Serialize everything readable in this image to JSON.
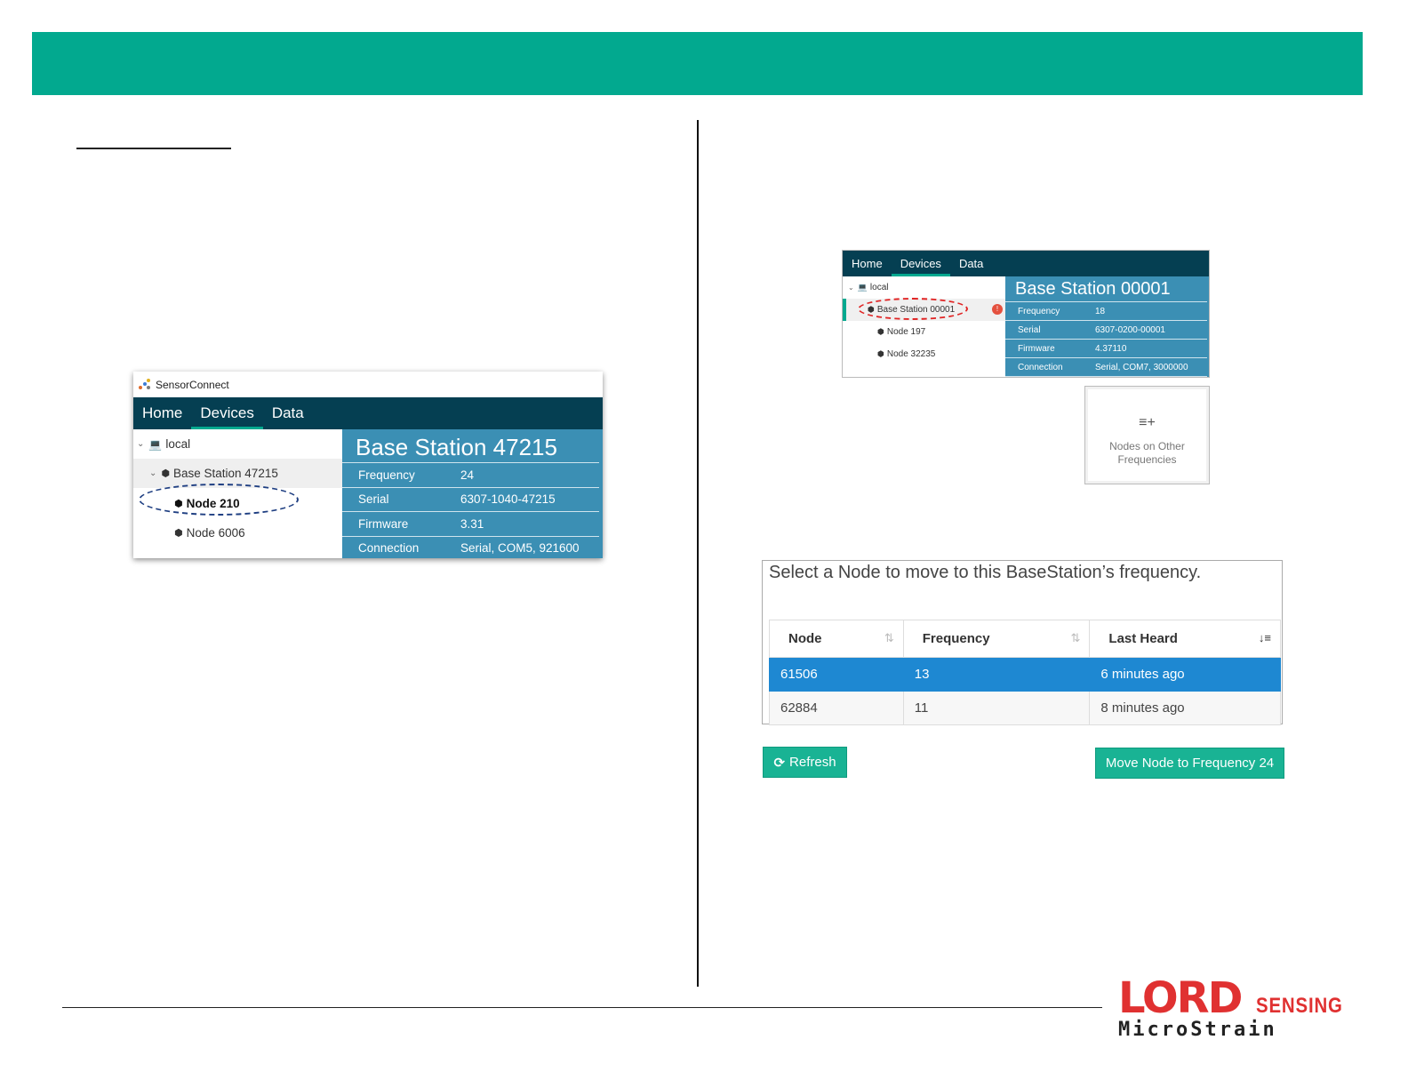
{
  "colors": {
    "banner": "#02a98f",
    "nav_bg": "#053f52",
    "panel_bg": "#3b8fb4",
    "button_bg": "#19b394",
    "selection": "#1e88d2",
    "logo_red": "#e03131"
  },
  "shot1": {
    "app_title": "SensorConnect",
    "tabs": [
      "Home",
      "Devices",
      "Data"
    ],
    "active_tab": "Devices",
    "tree": [
      {
        "label": "local",
        "icon": "laptop-icon"
      },
      {
        "label": "Base Station 47215",
        "icon": "device-icon"
      },
      {
        "label": "Node 210",
        "icon": "device-icon"
      },
      {
        "label": "Node 6006",
        "icon": "device-icon"
      }
    ],
    "panel_title": "Base Station 47215",
    "properties": [
      {
        "key": "Frequency",
        "value": "24"
      },
      {
        "key": "Serial",
        "value": "6307-1040-47215"
      },
      {
        "key": "Firmware",
        "value": "3.31"
      },
      {
        "key": "Connection",
        "value": "Serial, COM5, 921600"
      }
    ]
  },
  "shot2": {
    "tabs": [
      "Home",
      "Devices",
      "Data"
    ],
    "active_tab": "Devices",
    "tree": [
      {
        "label": "local",
        "icon": "laptop-icon"
      },
      {
        "label": "Base Station 00001",
        "icon": "device-icon"
      },
      {
        "label": "Node 197",
        "icon": "device-icon"
      },
      {
        "label": "Node 32235",
        "icon": "device-icon"
      }
    ],
    "badge": "!",
    "panel_title": "Base Station 00001",
    "properties": [
      {
        "key": "Frequency",
        "value": "18"
      },
      {
        "key": "Serial",
        "value": "6307-0200-00001"
      },
      {
        "key": "Firmware",
        "value": "4.37110"
      },
      {
        "key": "Connection",
        "value": "Serial, COM7, 3000000"
      }
    ],
    "nodes_card": {
      "line1": "Nodes on Other",
      "line2": "Frequencies"
    }
  },
  "dialog": {
    "prompt": "Select a Node to move to this BaseStation’s frequency.",
    "columns": [
      "Node",
      "Frequency",
      "Last Heard"
    ],
    "rows": [
      {
        "node": "61506",
        "frequency": "13",
        "last_heard": "6 minutes ago",
        "selected": true
      },
      {
        "node": "62884",
        "frequency": "11",
        "last_heard": "8 minutes ago",
        "selected": false
      }
    ],
    "refresh_label": "Refresh",
    "move_label": "Move Node to Frequency 24"
  },
  "logo": {
    "brand": "LORD",
    "sensing": "SENSING",
    "sub": "MicroStrain"
  }
}
